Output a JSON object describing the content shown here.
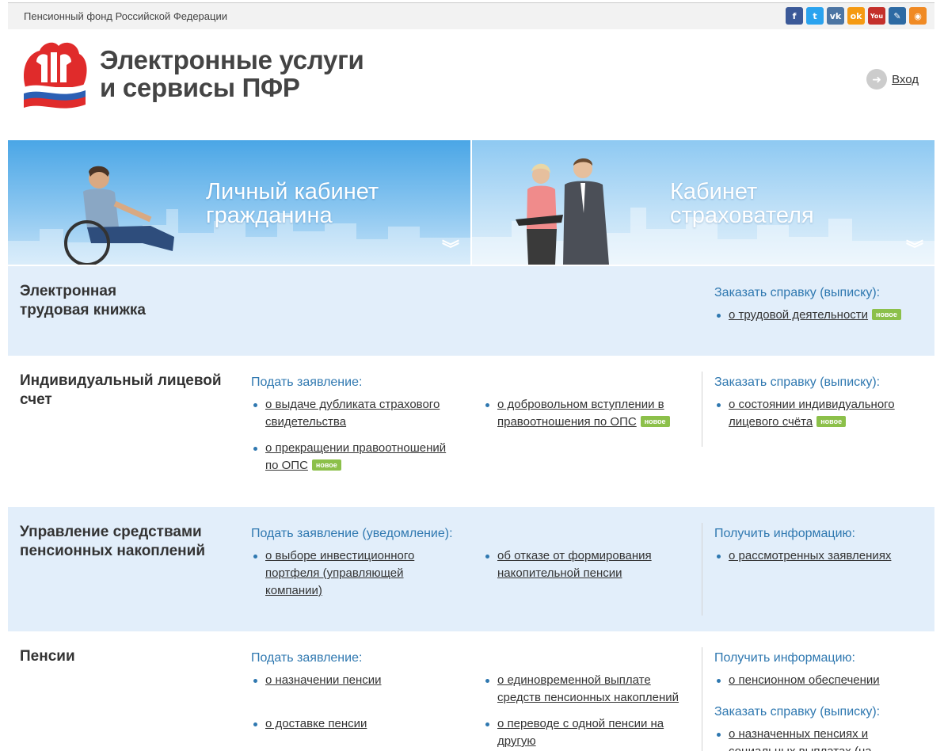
{
  "header": {
    "org": "Пенсионный фонд Российской Федерации",
    "site_title_line1": "Электронные услуги",
    "site_title_line2": "и сервисы ПФР",
    "login": "Вход",
    "social": [
      {
        "name": "facebook-icon",
        "glyph": "f",
        "color": "#3b5998"
      },
      {
        "name": "twitter-icon",
        "glyph": "t",
        "color": "#2aa3ef"
      },
      {
        "name": "vk-icon",
        "glyph": "vk",
        "color": "#4c75a3"
      },
      {
        "name": "odnoklassniki-icon",
        "glyph": "ok",
        "color": "#f59a12"
      },
      {
        "name": "youtube-icon",
        "glyph": "You",
        "color": "#c4302b"
      },
      {
        "name": "livejournal-icon",
        "glyph": "✎",
        "color": "#2d6aa3"
      },
      {
        "name": "rss-icon",
        "glyph": "◉",
        "color": "#f08a24"
      }
    ]
  },
  "banners": {
    "citizen_line1": "Личный кабинет",
    "citizen_line2": "гражданина",
    "insurer_line1": "Кабинет",
    "insurer_line2": "страхователя"
  },
  "sections": {
    "labor_book": {
      "title_line1": "Электронная",
      "title_line2": "трудовая книжка",
      "col3_head": "Заказать справку (выписку):",
      "col3_items": [
        {
          "text": "о трудовой деятельности",
          "badge": "новое"
        }
      ]
    },
    "personal_account": {
      "title_line1": "Индивидуальный лицевой",
      "title_line2": "счет",
      "col1_head": "Подать заявление:",
      "col1_item1_l1": "о выдаче дубликата страхового",
      "col1_item1_l2": "свидетельства",
      "col1_item2_l1": "о прекращении правоотношений",
      "col1_item2_l2": "по ОПС",
      "col1_item2_badge": "новое",
      "col2_item1_l1": "о добровольном вступлении в",
      "col2_item1_l2": "правоотношения по ОПС",
      "col2_item1_badge": "новое",
      "col3_head": "Заказать справку (выписку):",
      "col3_item1_l1": "о состоянии индивидуального",
      "col3_item1_l2": "лицевого счёта",
      "col3_item1_badge": "новое"
    },
    "savings": {
      "title_line1": "Управление средствами",
      "title_line2": "пенсионных накоплений",
      "col1_head": "Подать заявление (уведомление):",
      "col1_item1_l1": "о выборе инвестиционного",
      "col1_item1_l2": "портфеля (управляющей",
      "col1_item1_l3": "компании)",
      "col2_item1_l1": "об отказе от формирования",
      "col2_item1_l2": "накопительной пенсии",
      "col3_head": "Получить информацию:",
      "col3_item1": "о рассмотренных заявлениях"
    },
    "pensions": {
      "title": "Пенсии",
      "col1_head": "Подать заявление:",
      "col1_item1": "о назначении пенсии",
      "col1_item2": "о доставке пенсии",
      "col2_item1_l1": "о единовременной выплате",
      "col2_item1_l2": "средств пенсионных накоплений",
      "col2_item2_l1": "о переводе с одной пенсии на",
      "col2_item2_l2": "другую",
      "col3_head": "Получить информацию:",
      "col3_item1": "о пенсионном обеспечении",
      "col3_head2": "Заказать справку (выписку):",
      "col3_item2_l1": "о назначенных пенсиях и",
      "col3_item2_l2": "социальных выплатах (на"
    }
  }
}
